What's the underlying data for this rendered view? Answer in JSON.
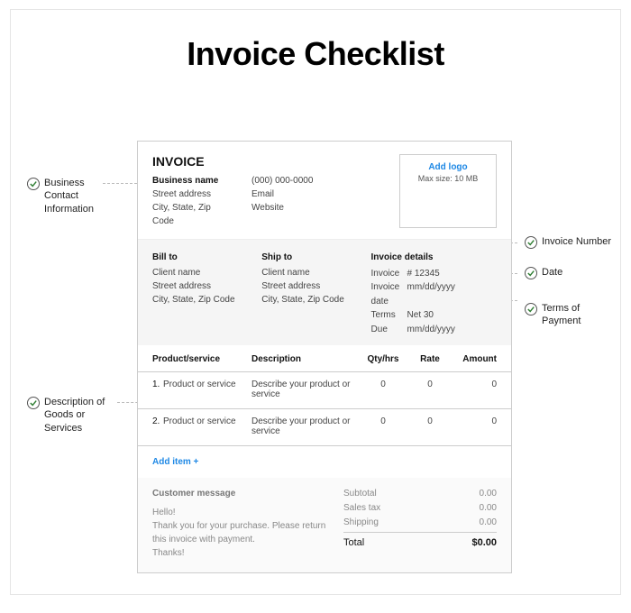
{
  "page_title": "Invoice Checklist",
  "invoice": {
    "label": "INVOICE",
    "business": {
      "name": "Business name",
      "phone": "(000) 000-0000",
      "street": "Street address",
      "email": "Email",
      "city_state_zip": "City, State, Zip Code",
      "website": "Website"
    },
    "logo": {
      "add": "Add logo",
      "max": "Max size: 10 MB"
    },
    "bill_to": {
      "heading": "Bill to",
      "client": "Client name",
      "street": "Street address",
      "csz": "City, State, Zip Code"
    },
    "ship_to": {
      "heading": "Ship to",
      "client": "Client name",
      "street": "Street address",
      "csz": "City, State, Zip Code"
    },
    "details": {
      "heading": "Invoice details",
      "inv_label": "Invoice",
      "inv_num": "# 12345",
      "date_label": "Invoice date",
      "date_val": "mm/dd/yyyy",
      "terms_label": "Terms",
      "terms_val": "Net 30",
      "due_label": "Due",
      "due_val": "mm/dd/yyyy"
    },
    "columns": {
      "product": "Product/service",
      "description": "Description",
      "qty": "Qty/hrs",
      "rate": "Rate",
      "amount": "Amount"
    },
    "rows": [
      {
        "n": "1.",
        "prod": "Product or service",
        "desc": "Describe your product or service",
        "qty": "0",
        "rate": "0",
        "amt": "0"
      },
      {
        "n": "2.",
        "prod": "Product or service",
        "desc": "Describe your product or service",
        "qty": "0",
        "rate": "0",
        "amt": "0"
      }
    ],
    "add_item": "Add item +",
    "message": {
      "heading": "Customer message",
      "line1": "Hello!",
      "line2": "Thank you for your purchase. Please return this invoice with payment.",
      "line3": "Thanks!"
    },
    "totals": {
      "subtotal_label": "Subtotal",
      "subtotal": "0.00",
      "tax_label": "Sales tax",
      "tax": "0.00",
      "ship_label": "Shipping",
      "ship": "0.00",
      "total_label": "Total",
      "total": "$0.00"
    }
  },
  "callouts": {
    "business": "Business Contact Information",
    "invoice_number": "Invoice Number",
    "date": "Date",
    "terms": "Terms of Payment",
    "description": "Description of Goods or Services"
  }
}
